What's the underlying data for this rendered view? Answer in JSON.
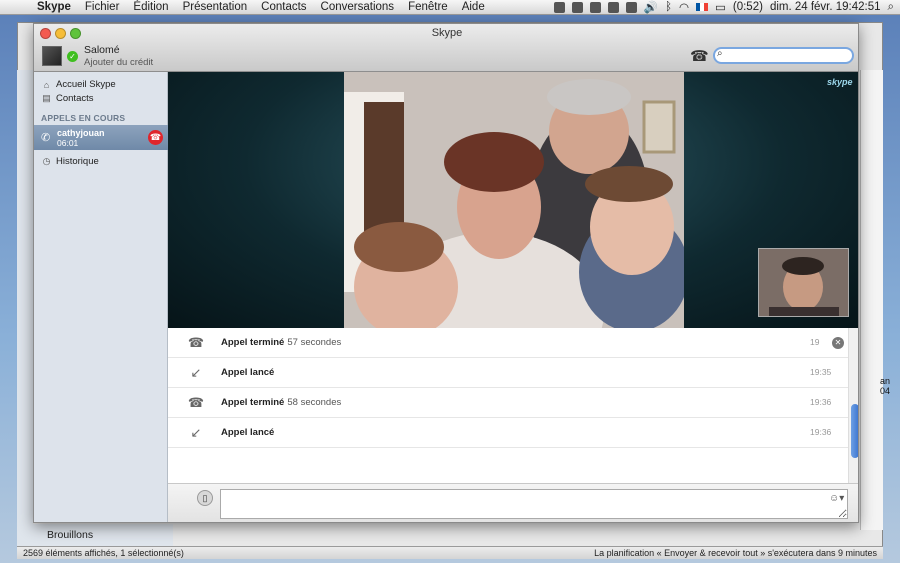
{
  "menubar": {
    "items": [
      "Skype",
      "Fichier",
      "Édition",
      "Présentation",
      "Contacts",
      "Conversations",
      "Fenêtre",
      "Aide"
    ],
    "battery": "(0:52)",
    "clock": "dim. 24 févr.  19:42:51"
  },
  "window": {
    "title": "Skype",
    "user_name": "Salomé",
    "user_credit": "Ajouter du crédit",
    "search_value": ""
  },
  "sidebar": {
    "home": "Accueil Skype",
    "contacts": "Contacts",
    "section": "APPELS EN COURS",
    "call_name": "cathyjouan",
    "call_time": "06:01",
    "history": "Historique"
  },
  "video": {
    "logo": "skype"
  },
  "history": {
    "rows": [
      {
        "label": "Appel terminé",
        "detail": "57 secondes",
        "time": "19"
      },
      {
        "label": "Appel lancé",
        "detail": "",
        "time": "19:35"
      },
      {
        "label": "Appel terminé",
        "detail": "58 secondes",
        "time": "19:36"
      },
      {
        "label": "Appel lancé",
        "detail": "",
        "time": "19:36"
      }
    ]
  },
  "background_mail": {
    "drafts": "Brouillons",
    "status_left": "2569 éléments affichés, 1 sélectionné(s)",
    "status_right": "La planification « Envoyer & recevoir tout » s'exécutera dans 9 minutes",
    "right_text_1": "an",
    "right_text_2": "04"
  },
  "colors": {
    "accent": "#3875d7",
    "online": "#3fbf1f",
    "hangup": "#e0252c"
  }
}
